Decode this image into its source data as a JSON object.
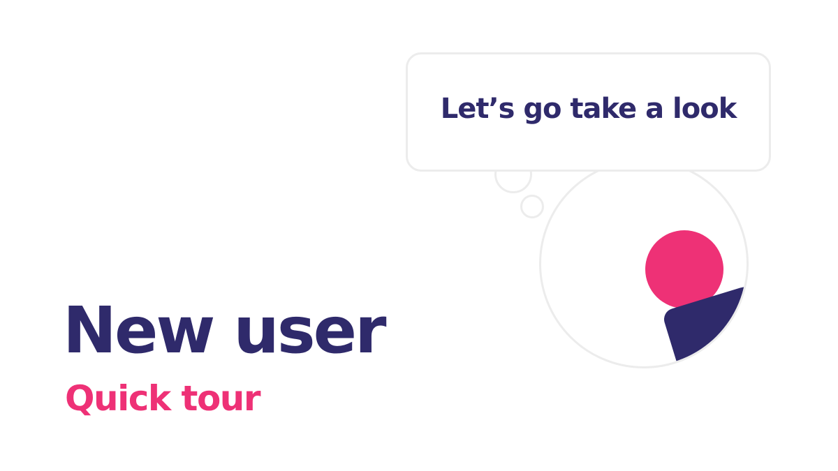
{
  "heading": {
    "title": "New user",
    "subtitle": "Quick tour"
  },
  "speech_bubble": {
    "text": "Let’s go take a look"
  },
  "colors": {
    "navy": "#2f2a6b",
    "pink": "#ee3176",
    "outline": "#ececec",
    "background": "#ffffff"
  },
  "icons": {
    "avatar": "person-avatar-icon",
    "thought_dots": "thought-bubble-dots"
  }
}
